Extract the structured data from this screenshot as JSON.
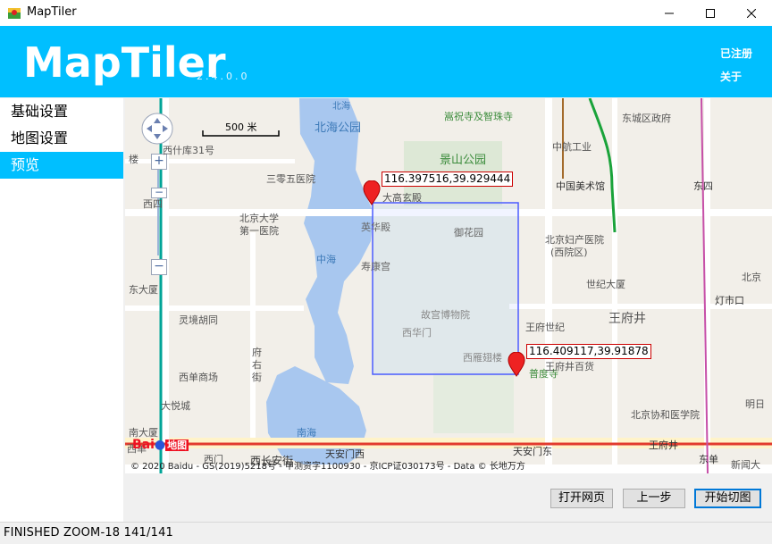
{
  "window": {
    "title": "MapTiler"
  },
  "header": {
    "brand": "MapTiler",
    "version": "2.4.0.0",
    "registered": "已注册",
    "about": "关于"
  },
  "sidebar": {
    "items": [
      {
        "label": "基础设置"
      },
      {
        "label": "地图设置"
      },
      {
        "label": "预览"
      }
    ]
  },
  "map": {
    "scale_label": "500 米",
    "copyright": "© 2020 Baidu - GS(2019)5218号 - 甲测资字1100930 - 京ICP证030173号 - Data © 长地万方",
    "marker_nw": "116.397516,39.929444",
    "marker_se": "116.409117,39.91878",
    "logo_text": "地图",
    "logo_bai": "Bai",
    "labels": {
      "beihai_north": "北海",
      "beihai_park": "北海公园",
      "songqingling": "嵩祝寺及智珠寺",
      "dongcheng": "东城区政府",
      "zhonghang": "中航工业",
      "xishiku": "西什库31号",
      "jingshan": "景山公园",
      "sanling": "三零五医院",
      "dagaoxuan": "大高玄殿",
      "meishuguan": "中国美术馆",
      "dongsi": "东四",
      "xisi": "西四",
      "pku1": "北京大学",
      "pku2": "第一医院",
      "yinghua": "英华殿",
      "yuhuayuan": "御花园",
      "fuchan1": "北京妇产医院",
      "fuchan2": "(西院区)",
      "zhonghai": "中海",
      "shoukang": "寿康宫",
      "shiji": "世纪大厦",
      "beijing_r": "北京",
      "lingjing": "灵境胡同",
      "gugong": "故宫博物院",
      "dengshikou": "灯市口",
      "dongsha": "东大厦",
      "wangfushiji": "王府世纪",
      "wangfujing": "王府井",
      "xihuamen": "西华门",
      "xiyaozi": "西雁翅楼",
      "fuyou1": "府",
      "fuyou2": "右",
      "fuyou3": "街",
      "xidan": "西单商场",
      "pudusi": "普度寺",
      "wangfubaihuo": "王府井百货",
      "dayuecheng": "大悦城",
      "xiehe": "北京协和医学院",
      "nandasha": "南大厦",
      "nanhai": "南海",
      "tiananmen_w": "天安门西",
      "tiananmen_e": "天安门东",
      "wangfujing_st": "王府井",
      "dongdan": "东单",
      "xinqiao": "新闻大",
      "xidan_st": "西单",
      "changan": "西长安街",
      "mingr": "明日",
      "lou": "楼",
      "xizhimen": "西门"
    }
  },
  "buttons": {
    "open_web": "打开网页",
    "prev": "上一步",
    "start": "开始切图"
  },
  "status": {
    "text": "FINISHED  ZOOM-18  141/141"
  }
}
